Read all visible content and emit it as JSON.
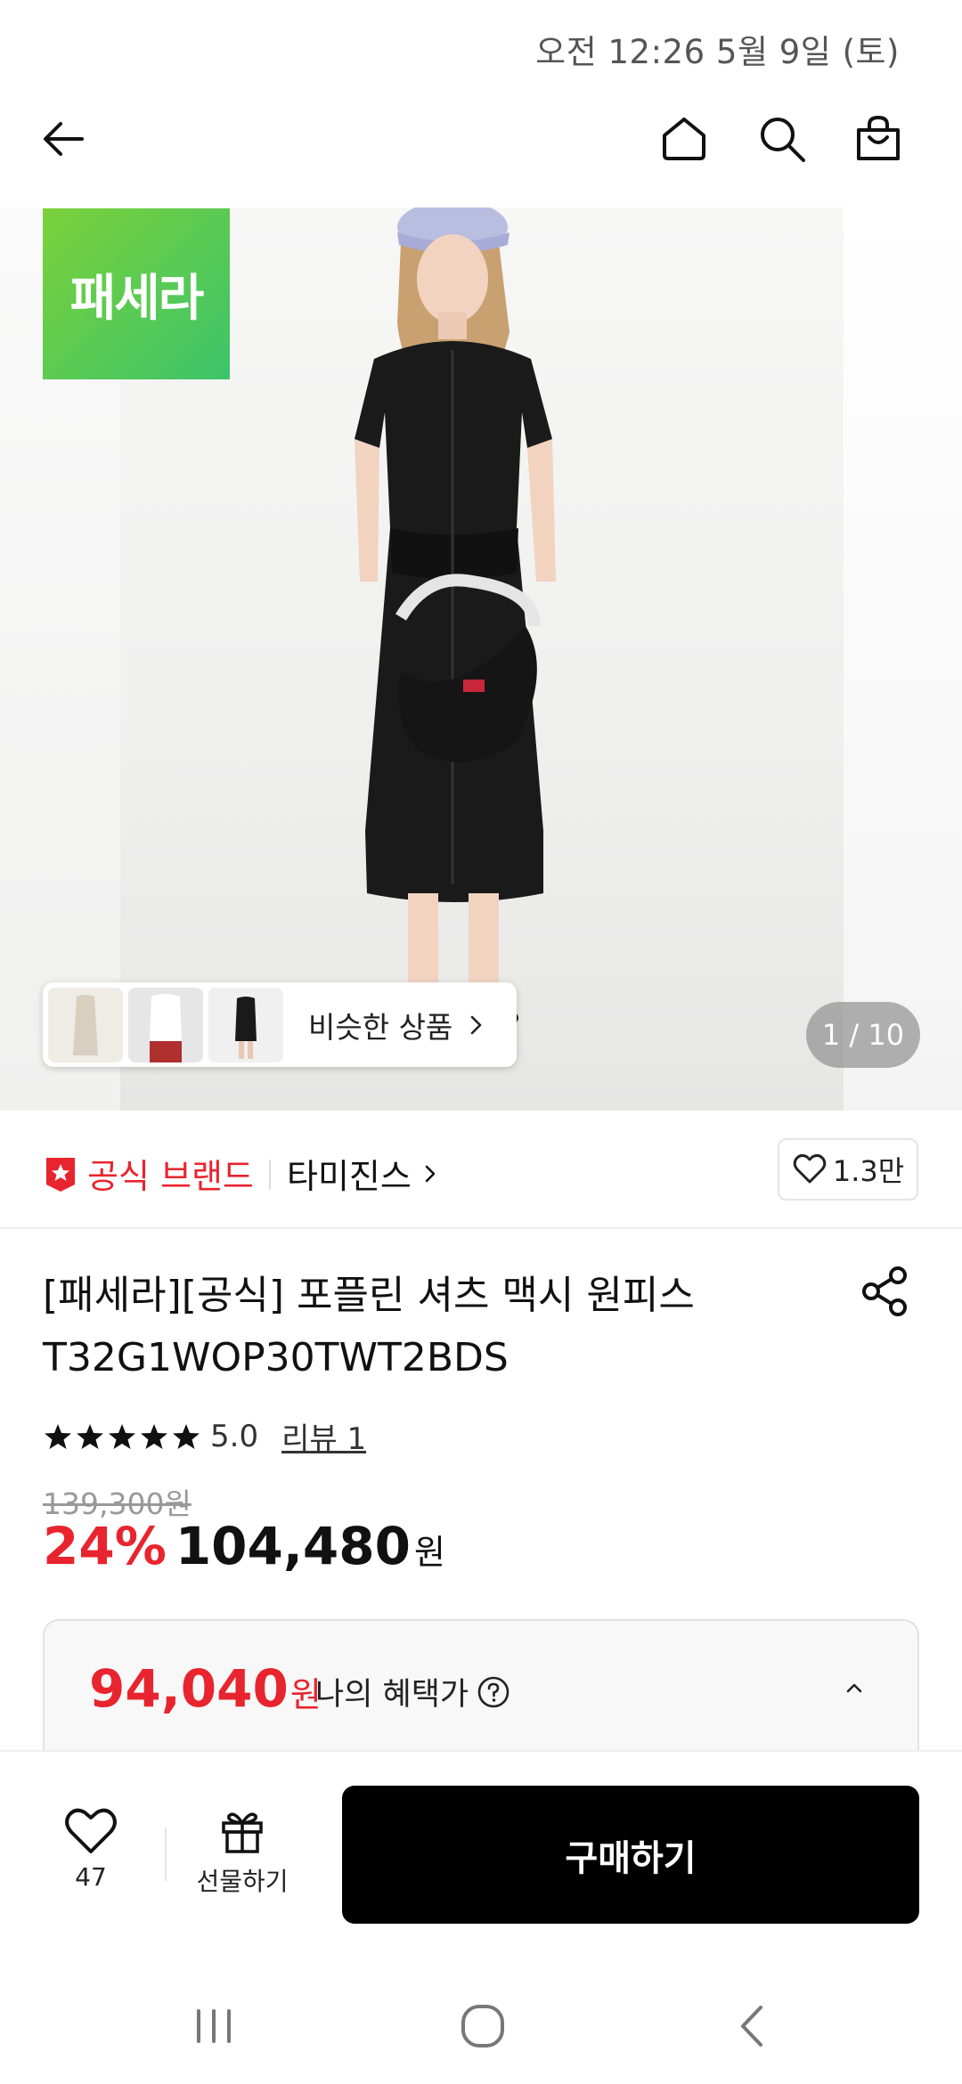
{
  "status_bar": {
    "time": "오전 12:26  5월 9일 (토)"
  },
  "nav": {
    "back_icon": "arrow-left-icon",
    "home_icon": "home-icon",
    "search_icon": "search-icon",
    "cart_icon": "shopping-bag-icon"
  },
  "hero": {
    "brand_logo_text": "패세라",
    "similar_label": "비슷한 상품",
    "page_indicator": "1 / 10"
  },
  "brand": {
    "official_label": "공식 브랜드",
    "name": "타미진스",
    "like_count": "1.3만"
  },
  "product": {
    "title": "[패세라][공식] 포플린 셔츠 맥시 원피스 T32G1WOP30TWT2BDS",
    "rating": 5.0,
    "rating_text": "5.0",
    "review_label": "리뷰 1",
    "original_price": "139,300원",
    "discount": "24%",
    "price": "104,480",
    "price_unit": "원"
  },
  "benefit": {
    "price": "94,040",
    "unit": "원",
    "label": "나의 혜택가"
  },
  "bottom_bar": {
    "wish_count": "47",
    "gift_label": "선물하기",
    "buy_label": "구매하기"
  },
  "colors": {
    "accent_red": "#e8242e",
    "logo_green": "#3cc46a",
    "buy_button": "#000000"
  }
}
